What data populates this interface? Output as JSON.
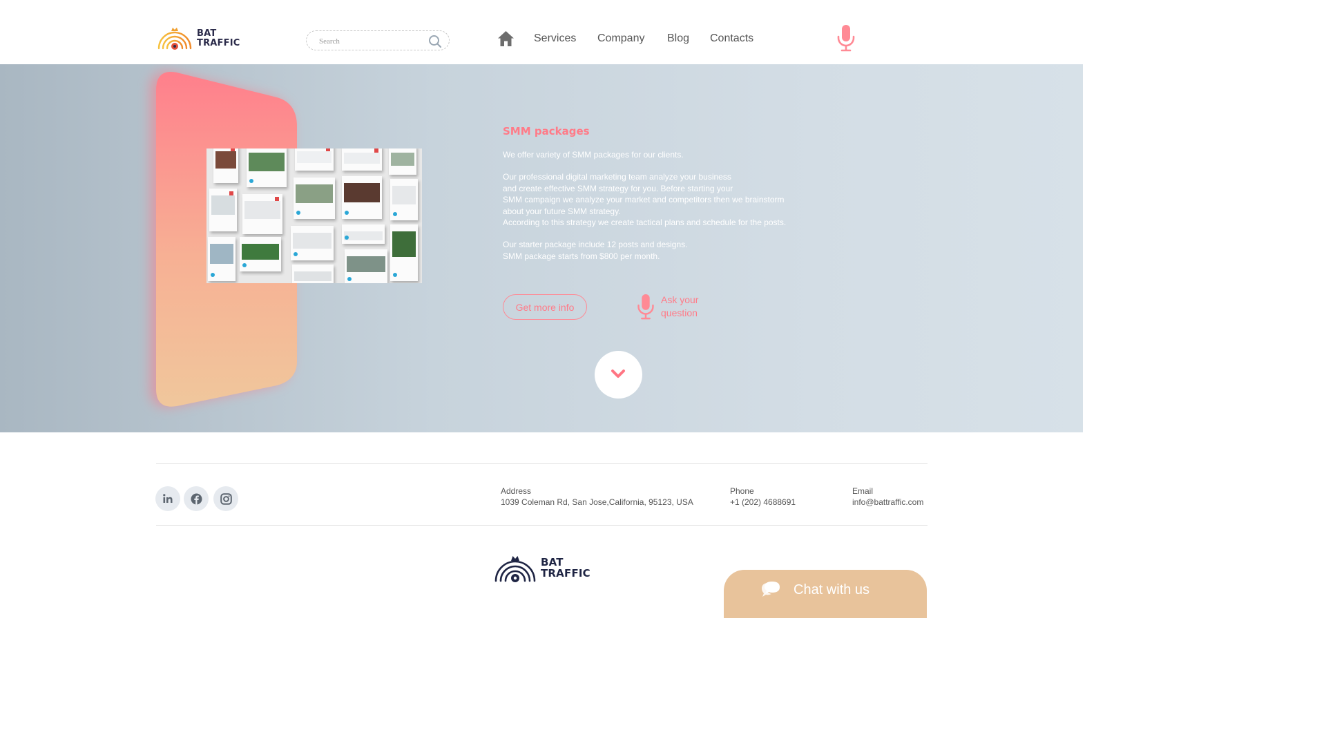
{
  "brand": {
    "line1": "BAT",
    "line2": "TRAFFIC"
  },
  "search": {
    "placeholder": "Search",
    "icon": "search-icon"
  },
  "nav": {
    "home_icon": "home-icon",
    "items": [
      "Services",
      "Company",
      "Blog",
      "Contacts"
    ],
    "voice_icon": "microphone-icon"
  },
  "hero": {
    "title": "SMM packages",
    "paragraphs": [
      "We offer variety of SMM packages for our clients.",
      "Our professional digital marketing team analyze your business\nand create effective SMM strategy for you. Before starting your\nSMM campaign we analyze your market and competitors then we brainstorm\nabout your future SMM strategy.\nAccording to this strategy we create tactical plans and schedule for the posts.",
      "Our starter package include 12 posts and designs.\nSMM package starts from  $800 per month."
    ],
    "cta_label": "Get more info",
    "ask_label": "Ask your question",
    "scroll_icon": "chevron-down-icon"
  },
  "footer": {
    "social": [
      "linkedin-icon",
      "facebook-icon",
      "instagram-icon"
    ],
    "address_label": "Address",
    "address_value": "1039 Coleman Rd, San Jose,California,  95123, USA",
    "phone_label": "Phone",
    "phone_value": "+1 (202) 4688691",
    "email_label": "Email",
    "email_value": "info@battraffic.com"
  },
  "chat": {
    "label": "Chat with us",
    "icon": "chat-bubbles-icon"
  },
  "colors": {
    "accent": "#ff7b88",
    "chat": "#e8c39b",
    "logo_dark": "#1f2544",
    "logo_warm": "#f0a030"
  }
}
